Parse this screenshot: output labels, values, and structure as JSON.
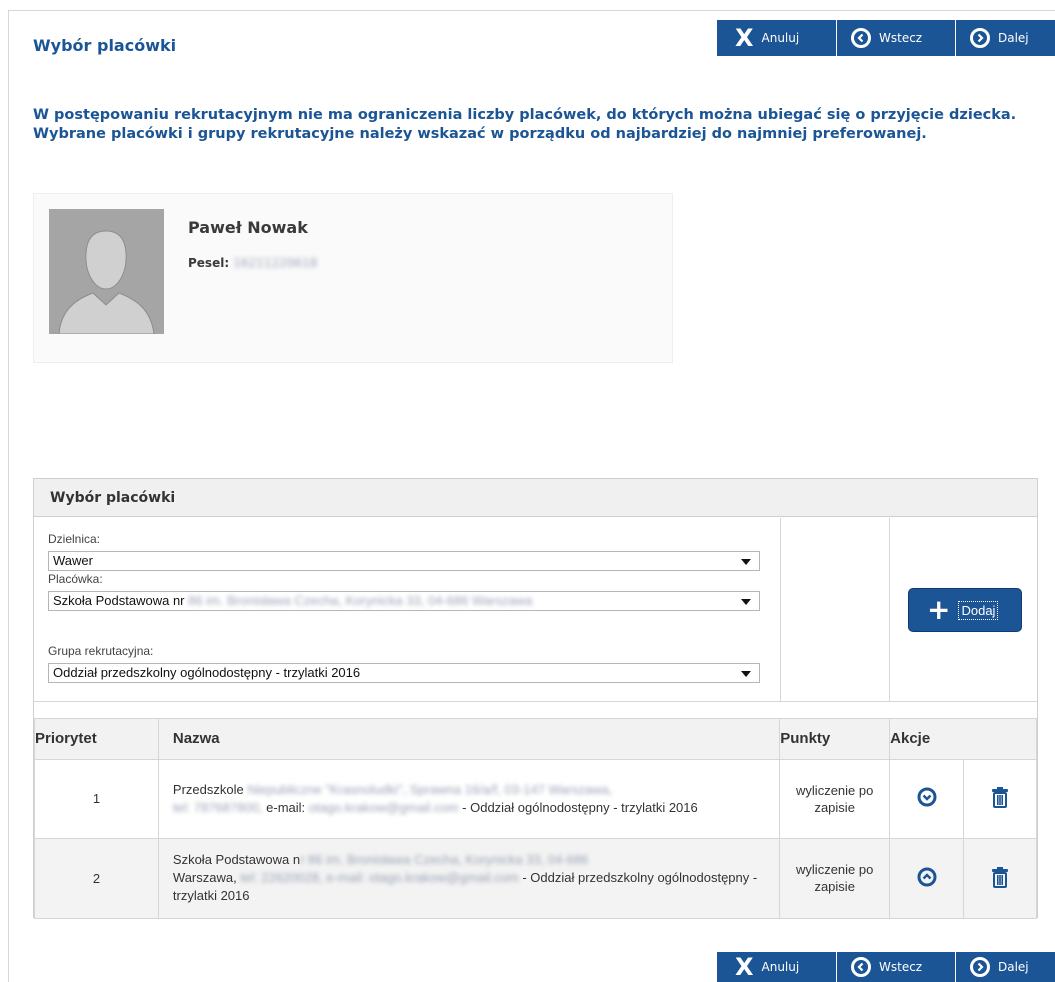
{
  "toolbar": {
    "cancel_label": "Anuluj",
    "back_label": "Wstecz",
    "next_label": "Dalej"
  },
  "page": {
    "title": "Wybór placówki",
    "info": "W postępowaniu rekrutacyjnym nie ma ograniczenia liczby placówek, do których można ubiegać się o przyjęcie dziecka. Wybrane placówki i grupy rekrutacyjne należy wskazać w porządku od najbardziej do najmniej preferowanej."
  },
  "person": {
    "name": "Paweł Nowak",
    "pesel_label": "Pesel:",
    "pesel_value": "16211220618"
  },
  "panel": {
    "title": "Wybór placówki",
    "district_label": "Dzielnica:",
    "district_value": "Wawer",
    "facility_label": "Placówka:",
    "facility_value_prefix": "Szkoła Podstawowa nr",
    "facility_value_hidden": " 86 im. Bronisława Czecha, Korynicka 33, 04-686 Warszawa",
    "group_label": "Grupa rekrutacyjna:",
    "group_value": "Oddział przedszkolny ogólnodostępny - trzylatki 2016",
    "add_label": "Dodaj"
  },
  "table": {
    "headers": {
      "priority": "Priorytet",
      "name": "Nazwa",
      "points": "Punkty",
      "actions": "Akcje"
    },
    "rows": [
      {
        "priority": "1",
        "name_a": "Przedszkole",
        "name_hidden_1": " Niepubliczne \"Krasnoludki\", Sprawna 16/a/f, 03-147 Warszawa,",
        "name_hidden_2": "tel: 787687800,",
        "name_b": " e-mail:",
        "name_hidden_3": " otago.krakow@gmail.com",
        "name_c": " - Oddział ogólnodostępny - trzylatki 2016",
        "points": "wyliczenie po zapisie"
      },
      {
        "priority": "2",
        "name_a": "Szkoła Podstawowa n",
        "name_hidden_1": "r 86 im. Bronisława Czecha, Korynicka 33, 04-686",
        "name_b": "Warszawa,",
        "name_hidden_2": " tel: 22620028, e-mail: otago.krakow@gmail.com",
        "name_c": " - Oddział przedszkolny ogólnodostępny - trzylatki 2016",
        "points": "wyliczenie po zapisie"
      }
    ]
  },
  "colors": {
    "brand": "#1b5595",
    "panel_header": "#f0f0f0",
    "avatar_bg": "#a5a5a5"
  },
  "icons": {
    "cancel": "x-icon",
    "back": "circle-chevron-left-icon",
    "next": "circle-chevron-right-icon",
    "add": "plus-icon",
    "move_down": "circle-chevron-down-icon",
    "move_up": "circle-chevron-up-icon",
    "delete": "trash-icon"
  }
}
